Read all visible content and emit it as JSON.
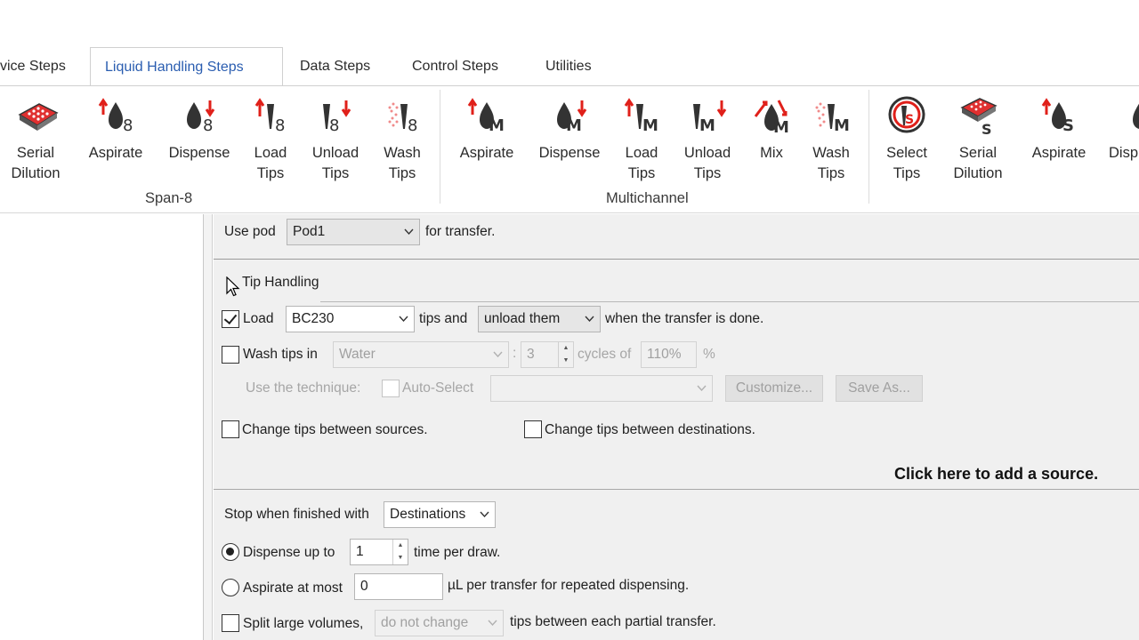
{
  "tabs": [
    {
      "label": "vice Steps"
    },
    {
      "label": "Liquid Handling Steps"
    },
    {
      "label": "Data Steps"
    },
    {
      "label": "Control Steps"
    },
    {
      "label": "Utilities"
    }
  ],
  "ribbon": {
    "span8": {
      "group_label": "Span-8",
      "buttons": [
        {
          "line1": "Serial",
          "line2": "Dilution",
          "icon": "serial-dilution-plate-icon"
        },
        {
          "line1": "Aspirate",
          "line2": "",
          "icon": "span8-aspirate-icon",
          "letter": "8"
        },
        {
          "line1": "Dispense",
          "line2": "",
          "icon": "span8-dispense-icon",
          "letter": "8"
        },
        {
          "line1": "Load",
          "line2": "Tips",
          "icon": "span8-load-tips-icon",
          "letter": "8"
        },
        {
          "line1": "Unload",
          "line2": "Tips",
          "icon": "span8-unload-tips-icon",
          "letter": "8"
        },
        {
          "line1": "Wash",
          "line2": "Tips",
          "icon": "span8-wash-tips-icon",
          "letter": "8"
        }
      ]
    },
    "multichannel": {
      "group_label": "Multichannel",
      "buttons": [
        {
          "line1": "Aspirate",
          "line2": "",
          "icon": "mc-aspirate-icon",
          "letter": "M"
        },
        {
          "line1": "Dispense",
          "line2": "",
          "icon": "mc-dispense-icon",
          "letter": "M"
        },
        {
          "line1": "Load",
          "line2": "Tips",
          "icon": "mc-load-tips-icon",
          "letter": "M"
        },
        {
          "line1": "Unload",
          "line2": "Tips",
          "icon": "mc-unload-tips-icon",
          "letter": "M"
        },
        {
          "line1": "Mix",
          "line2": "",
          "icon": "mc-mix-icon",
          "letter": "M"
        },
        {
          "line1": "Wash",
          "line2": "Tips",
          "icon": "mc-wash-tips-icon",
          "letter": "M"
        }
      ]
    },
    "selective": {
      "buttons": [
        {
          "line1": "Select",
          "line2": "Tips",
          "icon": "select-tips-icon",
          "letter": "S"
        },
        {
          "line1": "Serial",
          "line2": "Dilution",
          "icon": "serial-dilution-s-icon",
          "letter": "S"
        },
        {
          "line1": "Aspirate",
          "line2": "",
          "icon": "s-aspirate-icon",
          "letter": "S"
        },
        {
          "line1": "Disp",
          "line2": "",
          "icon": "s-dispense-icon",
          "letter": "S"
        }
      ]
    }
  },
  "form": {
    "use_pod_label": "Use pod",
    "pod_value": "Pod1",
    "for_transfer": "for transfer.",
    "tip_handling_label": "Tip Handling",
    "load_label": "Load",
    "tip_type": "BC230",
    "tips_and": "tips and",
    "unload_choice": "unload them",
    "when_done": "when the transfer is done.",
    "wash_tips_in": "Wash tips in",
    "wash_fluid": "Water",
    "colon": ":",
    "wash_cycles": "3",
    "cycles_of": "cycles of",
    "wash_percent": "110%",
    "percent_sign": "%",
    "use_technique": "Use the technique:",
    "auto_select": "Auto-Select",
    "customize": "Customize...",
    "save_as": "Save As...",
    "change_sources": "Change tips between sources.",
    "change_destinations": "Change tips between destinations.",
    "add_source": "Click here to add a source.",
    "stop_when": "Stop when finished with",
    "stop_choice": "Destinations",
    "dispense_up_to": "Dispense up to",
    "dispense_times": "1",
    "time_per_draw": "time per draw.",
    "aspirate_at_most": "Aspirate at most",
    "aspirate_volume": "0",
    "per_transfer": "µL per transfer for repeated dispensing.",
    "split_large": "Split large volumes,",
    "split_choice": "do not change",
    "split_tail": "tips between each partial transfer."
  },
  "colors": {
    "accent_tab": "#2a5db0",
    "arrow_red": "#e0201a",
    "icon_dark": "#333333"
  }
}
